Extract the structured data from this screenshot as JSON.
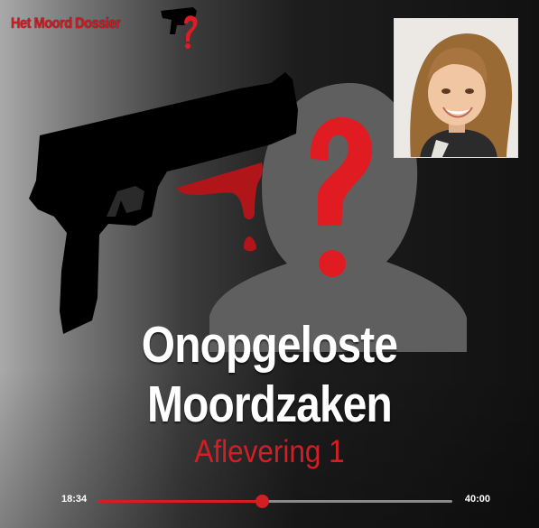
{
  "logo": {
    "text": "Het Moord Dossier",
    "icon": "pistol-question-icon"
  },
  "artwork": {
    "icons": [
      "pistol-icon",
      "blood-icon",
      "silhouette-icon",
      "question-mark-icon"
    ],
    "photo": "victim-portrait"
  },
  "title": {
    "line1": "Onopgeloste",
    "line2": "Moordzaken"
  },
  "episode": {
    "label": "Aflevering 1"
  },
  "player": {
    "current_time": "18:34",
    "total_time": "40:00",
    "progress": 0.464
  },
  "colors": {
    "accent": "#d21e24",
    "track": "#8a8a8a",
    "text": "#ffffff"
  }
}
